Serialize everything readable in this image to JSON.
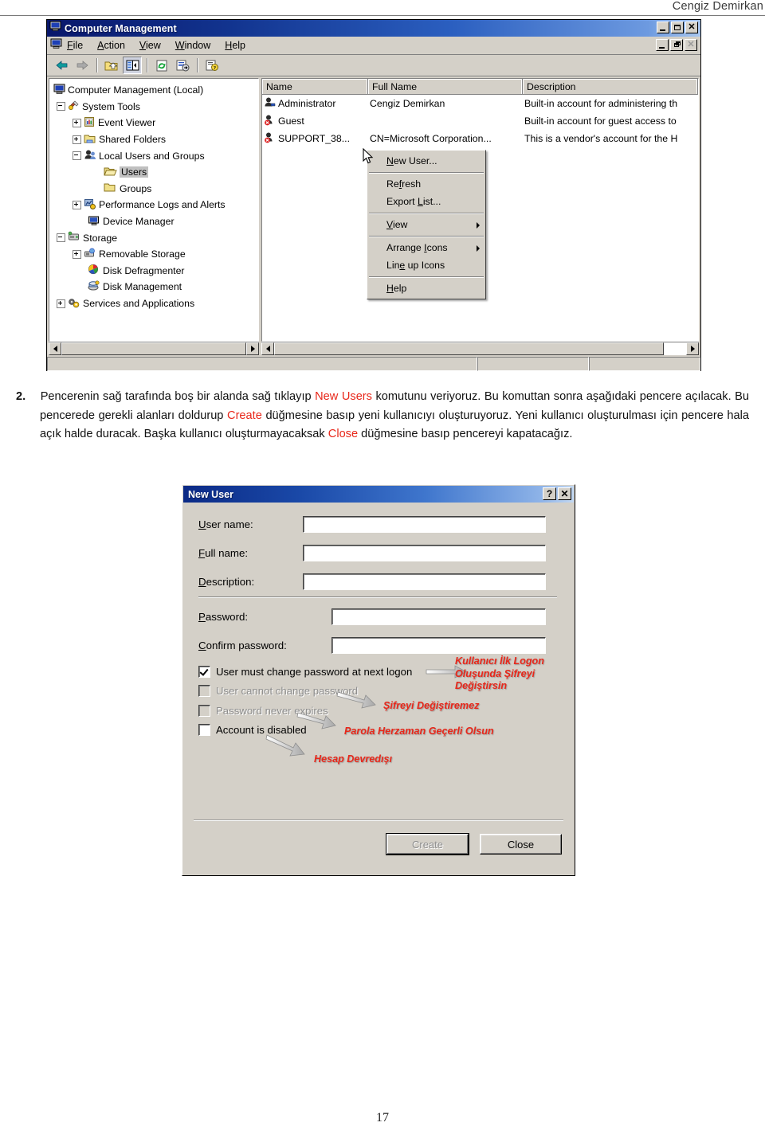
{
  "header": {
    "author": "Cengiz Demirkan"
  },
  "page": {
    "number": "17"
  },
  "cm_window": {
    "title": "Computer Management",
    "menus": [
      {
        "label": "File",
        "accel": "F"
      },
      {
        "label": "Action",
        "accel": "A"
      },
      {
        "label": "View",
        "accel": "V"
      },
      {
        "label": "Window",
        "accel": "W"
      },
      {
        "label": "Help",
        "accel": "H"
      }
    ],
    "toolbar": [
      {
        "name": "back-icon",
        "title": "Back"
      },
      {
        "name": "forward-icon",
        "title": "Forward"
      },
      {
        "name": "up-one-level-icon",
        "title": "Up One Level"
      },
      {
        "name": "show-hide-tree-icon",
        "title": "Show/Hide Console Tree"
      },
      {
        "name": "refresh-icon",
        "title": "Refresh"
      },
      {
        "name": "export-list-icon",
        "title": "Export List"
      },
      {
        "name": "help-icon",
        "title": "Help"
      }
    ],
    "tree": [
      {
        "label": "Computer Management (Local)",
        "depth": 0,
        "expander": "none",
        "icon": "computer-icon"
      },
      {
        "label": "System Tools",
        "depth": 1,
        "expander": "minus",
        "icon": "system-tools-icon"
      },
      {
        "label": "Event Viewer",
        "depth": 2,
        "expander": "plus",
        "icon": "event-viewer-icon"
      },
      {
        "label": "Shared Folders",
        "depth": 2,
        "expander": "plus",
        "icon": "shared-folders-icon"
      },
      {
        "label": "Local Users and Groups",
        "depth": 2,
        "expander": "minus",
        "icon": "local-users-icon"
      },
      {
        "label": "Users",
        "depth": 3,
        "expander": "none",
        "icon": "folder-open-icon",
        "selected": true
      },
      {
        "label": "Groups",
        "depth": 3,
        "expander": "none",
        "icon": "folder-icon"
      },
      {
        "label": "Performance Logs and Alerts",
        "depth": 2,
        "expander": "plus",
        "icon": "performance-icon"
      },
      {
        "label": "Device Manager",
        "depth": 2,
        "expander": "none",
        "icon": "device-manager-icon"
      },
      {
        "label": "Storage",
        "depth": 1,
        "expander": "minus",
        "icon": "storage-icon"
      },
      {
        "label": "Removable Storage",
        "depth": 2,
        "expander": "plus",
        "icon": "removable-storage-icon"
      },
      {
        "label": "Disk Defragmenter",
        "depth": 2,
        "expander": "none",
        "icon": "disk-defrag-icon"
      },
      {
        "label": "Disk Management",
        "depth": 2,
        "expander": "none",
        "icon": "disk-management-icon"
      },
      {
        "label": "Services and Applications",
        "depth": 1,
        "expander": "plus",
        "icon": "services-icon"
      }
    ],
    "list": {
      "columns": [
        "Name",
        "Full Name",
        "Description"
      ],
      "rows": [
        {
          "name": "Administrator",
          "full_name": "Cengiz Demirkan",
          "description": "Built-in account for administering th",
          "icon": "user-icon"
        },
        {
          "name": "Guest",
          "full_name": "",
          "description": "Built-in account for guest access to",
          "icon": "user-disabled-icon"
        },
        {
          "name": "SUPPORT_38...",
          "full_name": "CN=Microsoft Corporation...",
          "description": "This is a vendor's account for the H",
          "icon": "user-disabled-icon"
        }
      ]
    },
    "context_menu": [
      {
        "label": "New User...",
        "accel": "N",
        "submenu": false
      },
      {
        "separator": true
      },
      {
        "label": "Refresh",
        "accel": "f",
        "submenu": false
      },
      {
        "label": "Export List...",
        "accel": "L",
        "submenu": false
      },
      {
        "separator": true
      },
      {
        "label": "View",
        "accel": "V",
        "submenu": true
      },
      {
        "separator": true
      },
      {
        "label": "Arrange Icons",
        "accel": "I",
        "submenu": true
      },
      {
        "label": "Line up Icons",
        "accel": "e",
        "submenu": false
      },
      {
        "separator": true
      },
      {
        "label": "Help",
        "accel": "H",
        "submenu": false
      }
    ]
  },
  "paragraph": {
    "number": "2.",
    "p1": "Pencerenin sağ tarafında boş bir alanda sağ tıklayıp ",
    "kw1": "New Users",
    "p2": " komutunu veriyoruz. Bu komuttan sonra aşağıdaki pencere açılacak. Bu pencerede gerekli alanları doldurup ",
    "kw2": "Create",
    "p3": " düğmesine basıp yeni kullanıcıyı oluşturuyoruz. Yeni kullanıcı oluşturulması için pencere hala açık halde duracak. Başka kullanıcı oluşturmayacaksak ",
    "kw3": "Close",
    "p4": " düğmesine basıp pencereyi kapatacağız."
  },
  "new_user_dialog": {
    "title": "New User",
    "help_button": "?",
    "close_button": "✕",
    "fields": [
      {
        "label": "User name:",
        "accel": "U",
        "value": "",
        "placeholder": ""
      },
      {
        "label": "Full name:",
        "accel": "F",
        "value": "",
        "placeholder": ""
      },
      {
        "label": "Description:",
        "accel": "D",
        "value": "",
        "placeholder": ""
      },
      {
        "label": "Password:",
        "accel": "P",
        "value": "",
        "placeholder": ""
      },
      {
        "label": "Confirm password:",
        "accel": "C",
        "value": "",
        "placeholder": ""
      }
    ],
    "checkboxes": [
      {
        "label": "User must change password at next logon",
        "checked": true,
        "disabled": false
      },
      {
        "label": "User cannot change password",
        "checked": false,
        "disabled": true
      },
      {
        "label": "Password never expires",
        "checked": false,
        "disabled": true
      },
      {
        "label": "Account is disabled",
        "checked": false,
        "disabled": false
      }
    ],
    "annotations": [
      {
        "text": "Kullanıcı İlk Logon Oluşunda Şifreyi Değiştirsin",
        "color": "#e8271a"
      },
      {
        "text": "Şifreyi Değiştiremez",
        "color": "#e8271a"
      },
      {
        "text": "Parola Herzaman Geçerli Olsun",
        "color": "#e8271a"
      },
      {
        "text": "Hesap Devredışı",
        "color": "#e8271a"
      }
    ],
    "buttons": [
      {
        "label": "Create",
        "disabled": true,
        "default": true
      },
      {
        "label": "Close",
        "disabled": false,
        "default": false
      }
    ]
  }
}
